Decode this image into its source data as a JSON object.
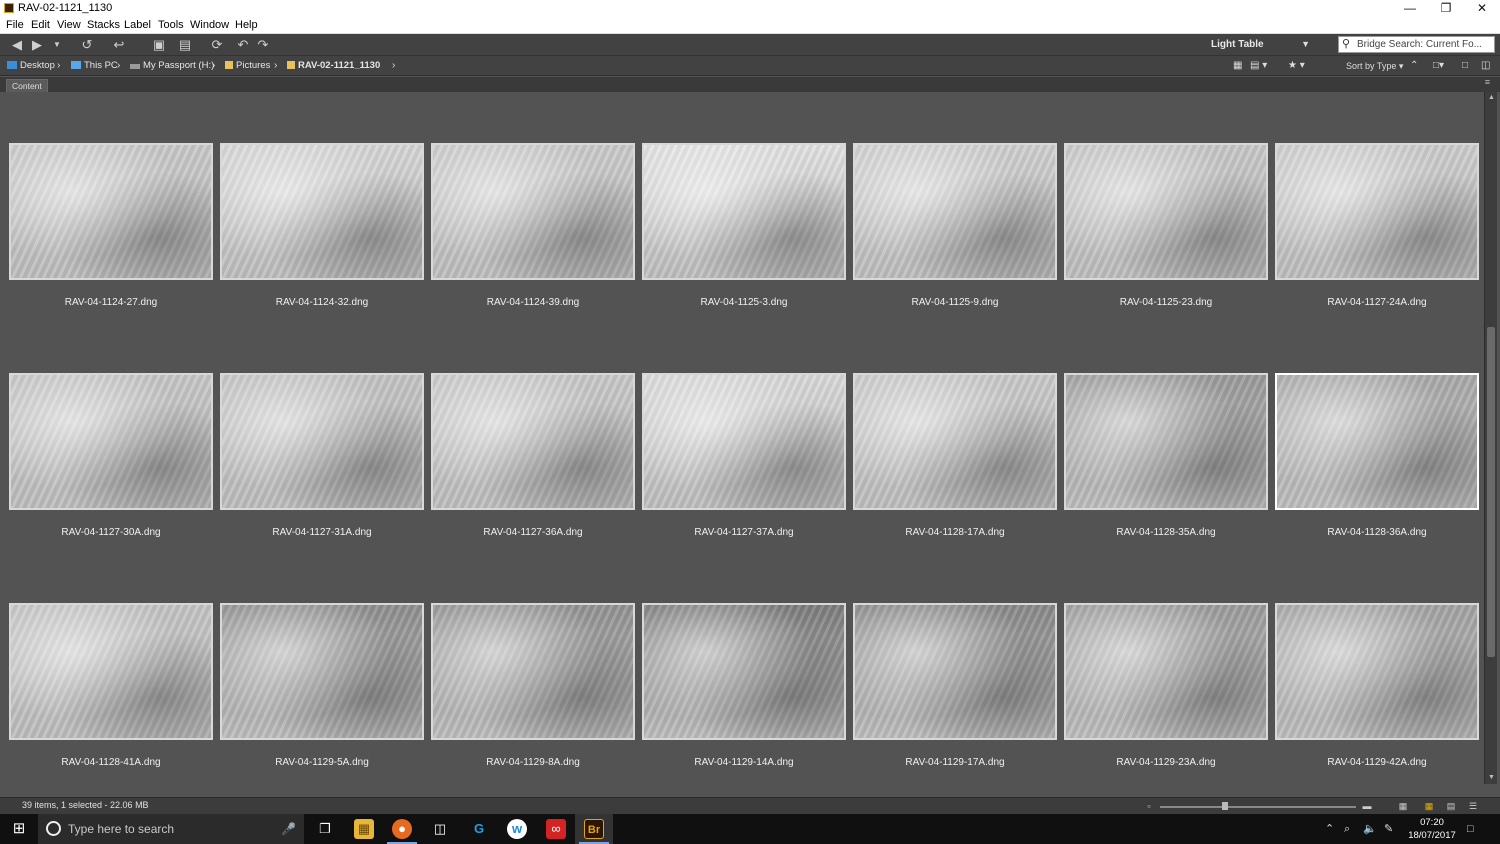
{
  "window": {
    "title": "RAV-02-1121_1130",
    "minimize": "—",
    "maximize": "❐",
    "close": "✕"
  },
  "menu": [
    "File",
    "Edit",
    "View",
    "Stacks",
    "Label",
    "Tools",
    "Window",
    "Help"
  ],
  "toolbar": {
    "workspace": "Light Table",
    "search_placeholder": "Bridge Search: Current Fo..."
  },
  "breadcrumb": {
    "items": [
      "Desktop",
      "This PC",
      "My Passport (H:)",
      "Pictures",
      "RAV-02-1121_1130"
    ]
  },
  "sort": {
    "label": "Sort by Type"
  },
  "panel": {
    "tab": "Content"
  },
  "thumbnails": [
    {
      "name": "RAV-04-1124-27.dng",
      "tone": "#c9c9c9",
      "selected": false
    },
    {
      "name": "RAV-04-1124-32.dng",
      "tone": "#d6d6d6",
      "selected": false
    },
    {
      "name": "RAV-04-1124-39.dng",
      "tone": "#cbcbcb",
      "selected": false
    },
    {
      "name": "RAV-04-1125-3.dng",
      "tone": "#e2e2e2",
      "selected": false
    },
    {
      "name": "RAV-04-1125-9.dng",
      "tone": "#cfcfcf",
      "selected": false
    },
    {
      "name": "RAV-04-1125-23.dng",
      "tone": "#c7c7c7",
      "selected": false
    },
    {
      "name": "RAV-04-1127-24A.dng",
      "tone": "#cdcdcd",
      "selected": false
    },
    {
      "name": "RAV-04-1127-30A.dng",
      "tone": "#c6c6c6",
      "selected": false
    },
    {
      "name": "RAV-04-1127-31A.dng",
      "tone": "#c3c3c3",
      "selected": false
    },
    {
      "name": "RAV-04-1127-36A.dng",
      "tone": "#c8c8c8",
      "selected": false
    },
    {
      "name": "RAV-04-1127-37A.dng",
      "tone": "#d9d9d9",
      "selected": false
    },
    {
      "name": "RAV-04-1128-17A.dng",
      "tone": "#c9c9c9",
      "selected": false
    },
    {
      "name": "RAV-04-1128-35A.dng",
      "tone": "#9a9a9a",
      "selected": false
    },
    {
      "name": "RAV-04-1128-36A.dng",
      "tone": "#a9a9a9",
      "selected": true
    },
    {
      "name": "RAV-04-1128-41A.dng",
      "tone": "#c4c4c4",
      "selected": false
    },
    {
      "name": "RAV-04-1129-5A.dng",
      "tone": "#8e8e8e",
      "selected": false
    },
    {
      "name": "RAV-04-1129-8A.dng",
      "tone": "#929292",
      "selected": false
    },
    {
      "name": "RAV-04-1129-14A.dng",
      "tone": "#7c7c7c",
      "selected": false
    },
    {
      "name": "RAV-04-1129-17A.dng",
      "tone": "#888888",
      "selected": false
    },
    {
      "name": "RAV-04-1129-23A.dng",
      "tone": "#9b9b9b",
      "selected": false
    },
    {
      "name": "RAV-04-1129-42A.dng",
      "tone": "#a3a3a3",
      "selected": false
    }
  ],
  "status": {
    "text": "39 items, 1 selected - 22.06 MB",
    "thumb_size": 0.33
  },
  "taskbar": {
    "search_placeholder": "Type here to search",
    "time": "07:20",
    "date": "18/07/2017"
  },
  "colors": {
    "content_bg": "#535353",
    "selection": "#ffffff",
    "frame": "#d8d8d8"
  }
}
